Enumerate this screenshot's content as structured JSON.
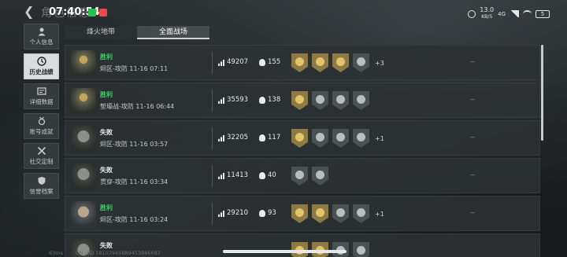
{
  "header": {
    "title": "角色信息",
    "clock": "07:40:54"
  },
  "system": {
    "net_speed_value": "13.0",
    "net_speed_unit": "KB/S",
    "network": "4G",
    "battery": "5"
  },
  "sidebar": {
    "items": [
      {
        "label": "个人信息",
        "icon": "person-icon",
        "active": false
      },
      {
        "label": "历史战绩",
        "icon": "history-icon",
        "active": true
      },
      {
        "label": "详细数据",
        "icon": "data-icon",
        "active": false
      },
      {
        "label": "账号成就",
        "icon": "achievement-icon",
        "active": false
      },
      {
        "label": "社交定制",
        "icon": "social-icon",
        "active": false
      },
      {
        "label": "信誉档案",
        "icon": "shield-icon",
        "active": false
      }
    ]
  },
  "tabs": [
    {
      "label": "烽火地带",
      "active": false
    },
    {
      "label": "全面战场",
      "active": true
    }
  ],
  "matches": [
    {
      "result": "胜利",
      "win": true,
      "mode": "烬区-攻防 11-16 07:11",
      "score": "49207",
      "kills": "155",
      "badges": [
        "gold",
        "gold",
        "gold",
        "silver"
      ],
      "more": "+3",
      "extra": "--"
    },
    {
      "result": "胜利",
      "win": true,
      "mode": "堑壕战-攻防 11-16 06:44",
      "score": "35593",
      "kills": "138",
      "badges": [
        "gold",
        "silver",
        "silver",
        "silver"
      ],
      "more": "",
      "extra": "--"
    },
    {
      "result": "失败",
      "win": false,
      "mode": "烬区-攻防 11-16 03:57",
      "score": "32205",
      "kills": "117",
      "badges": [
        "gold",
        "silver",
        "silver",
        "silver"
      ],
      "more": "+1",
      "extra": "--"
    },
    {
      "result": "失败",
      "win": false,
      "mode": "贯穿-攻防 11-16 03:34",
      "score": "11413",
      "kills": "40",
      "badges": [
        "silver",
        "silver"
      ],
      "more": "",
      "extra": "--"
    },
    {
      "result": "胜利",
      "win": true,
      "mode": "烬区-攻防 11-16 03:24",
      "score": "29210",
      "kills": "93",
      "badges": [
        "gold",
        "gold",
        "silver",
        "silver"
      ],
      "more": "+1",
      "extra": "--"
    },
    {
      "result": "失败",
      "win": false,
      "mode": "",
      "score": "",
      "kills": "",
      "badges": [
        "gold",
        "gold",
        "silver",
        "silver"
      ],
      "more": "",
      "extra": ""
    }
  ],
  "footer": {
    "fps": "63ms",
    "uid": "CN UID 18107945889453886687"
  },
  "colors": {
    "win": "#35d46a",
    "lose": "#e8ecec",
    "badge_gold": "#e5c36b",
    "badge_silver": "#b8bfc0"
  }
}
